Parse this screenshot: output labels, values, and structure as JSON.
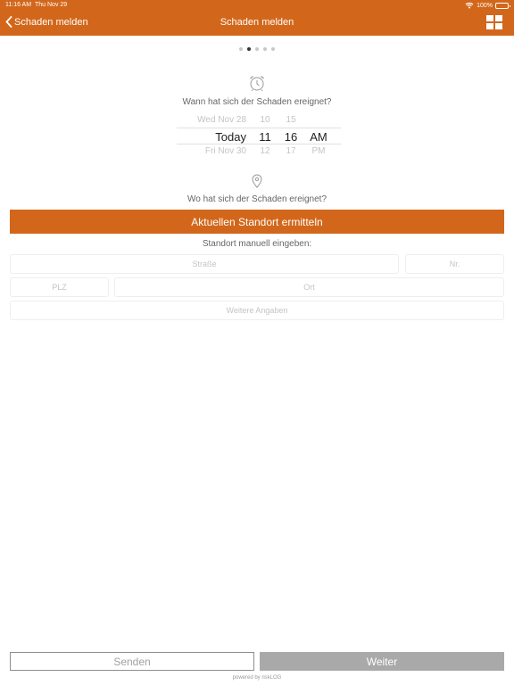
{
  "status_bar": {
    "time": "11:16 AM",
    "date": "Thu Nov 29",
    "battery": "100%"
  },
  "nav": {
    "back_label": "Schaden melden",
    "title": "Schaden melden"
  },
  "pager": {
    "count": 5,
    "active_index": 1
  },
  "when": {
    "question": "Wann hat sich der Schaden ereignet?",
    "picker": {
      "above": {
        "day": "Wed Nov 28",
        "hour": "10",
        "minute": "15",
        "ampm": ""
      },
      "selected": {
        "day": "Today",
        "hour": "11",
        "minute": "16",
        "ampm": "AM"
      },
      "below": {
        "day": "Fri Nov 30",
        "hour": "12",
        "minute": "17",
        "ampm": "PM"
      }
    }
  },
  "where": {
    "question": "Wo hat sich der Schaden ereignet?",
    "locate_button": "Aktuellen Standort ermitteln",
    "manual_label": "Standort manuell eingeben:",
    "street_placeholder": "Straße",
    "number_placeholder": "Nr.",
    "zip_placeholder": "PLZ",
    "city_placeholder": "Ort",
    "extra_placeholder": "Weitere Angaben"
  },
  "footer": {
    "send_label": "Senden",
    "next_label": "Weiter",
    "powered_by": "powered by riskLOG"
  },
  "colors": {
    "accent": "#d2671b",
    "disabled": "#a9a9a9"
  }
}
